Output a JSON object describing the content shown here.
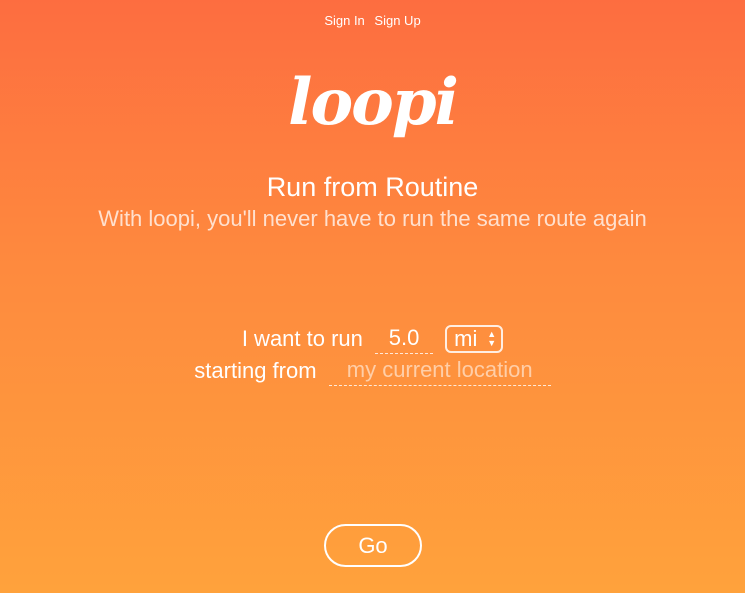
{
  "nav": {
    "sign_in": "Sign In",
    "sign_up": "Sign Up"
  },
  "logo": {
    "text": "loopi"
  },
  "hero": {
    "title": "Run from Routine",
    "subtitle": "With loopi, you'll never have to run the same route again"
  },
  "form": {
    "distance_label": "I want to run",
    "distance_value": "5.0",
    "unit_selected": "mi",
    "location_label": "starting from",
    "location_value": "",
    "location_placeholder": "my current location"
  },
  "actions": {
    "go_label": "Go"
  },
  "colors": {
    "gradient_top": "#fd6d40",
    "gradient_bottom": "#ffa23c",
    "text": "#ffffff"
  }
}
